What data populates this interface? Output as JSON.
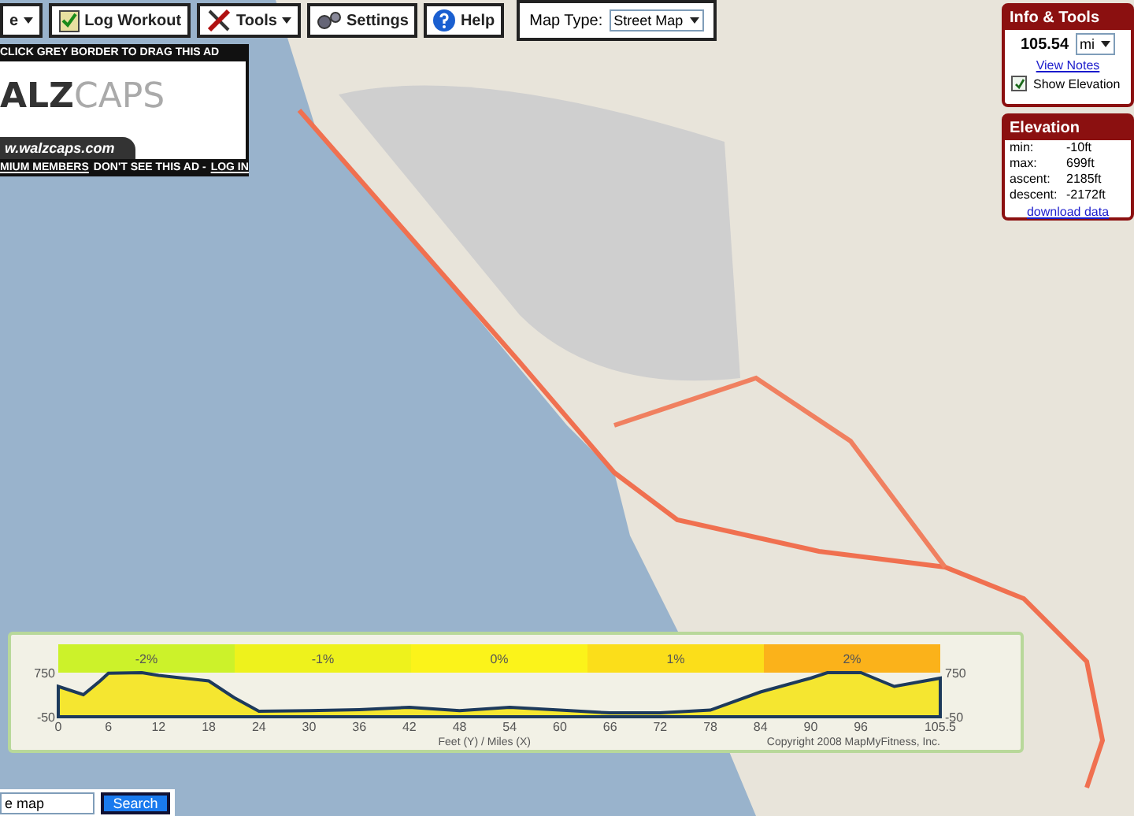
{
  "toolbar": {
    "items": [
      {
        "label": "e",
        "kind": "menu"
      },
      {
        "label": "Log Workout",
        "kind": "button"
      },
      {
        "label": "Tools",
        "kind": "menu"
      },
      {
        "label": "Settings",
        "kind": "button"
      },
      {
        "label": "Help",
        "kind": "button"
      }
    ],
    "map_type": {
      "label": "Map Type:",
      "value": "Street Map"
    }
  },
  "ad": {
    "header": "CLICK GREY BORDER TO DRAG THIS AD",
    "logo_left": "ALZ",
    "logo_right": "CAPS",
    "url": "w.walzcaps.com",
    "footer_link": "MIUM MEMBERS",
    "footer_text": "DON'T SEE THIS AD -",
    "footer_login": "LOG IN"
  },
  "info_panel": {
    "title": "Info & Tools",
    "distance": "105.54",
    "unit": "mi",
    "link": "View Notes",
    "show_elevation": {
      "label": "Show Elevation",
      "checked": true
    }
  },
  "elevation_panel": {
    "title": "Elevation",
    "stats": [
      {
        "label": "min:",
        "value": "-10ft"
      },
      {
        "label": "max:",
        "value": "699ft"
      },
      {
        "label": "ascent:",
        "value": "2185ft"
      },
      {
        "label": "descent:",
        "value": "-2172ft"
      }
    ],
    "link": "download data"
  },
  "elevation_chart": {
    "grade_bands": [
      {
        "label": "-2%",
        "color": "#ccf22a"
      },
      {
        "label": "-1%",
        "color": "#eef21c"
      },
      {
        "label": "0%",
        "color": "#fbf31a"
      },
      {
        "label": "1%",
        "color": "#fbde1a"
      },
      {
        "label": "2%",
        "color": "#fbb21a"
      }
    ],
    "right_axis_labels": [
      "750",
      "-50"
    ],
    "copyright": "Copyright 2008 MapMyFitness, Inc.",
    "chart_data": {
      "type": "area",
      "xlabel": "Feet (Y) / Miles (X)",
      "x": [
        0,
        3,
        5,
        6,
        10,
        12,
        18,
        21,
        24,
        30,
        36,
        42,
        48,
        54,
        60,
        66,
        72,
        78,
        84,
        90,
        92,
        96,
        100,
        105.5
      ],
      "series": [
        {
          "color": "#1d3a5c",
          "values": [
            500,
            350,
            600,
            740,
            750,
            700,
            600,
            300,
            50,
            60,
            80,
            120,
            60,
            120,
            70,
            20,
            20,
            70,
            400,
            650,
            750,
            750,
            500,
            650
          ]
        }
      ],
      "xlim": [
        0,
        105.5
      ],
      "ylim": [
        -50,
        750
      ],
      "xticks": [
        0,
        6,
        12,
        18,
        24,
        30,
        36,
        42,
        48,
        54,
        60,
        66,
        72,
        78,
        84,
        90,
        96,
        105.5
      ],
      "yticks": [
        -50,
        750
      ]
    }
  },
  "search": {
    "value": "e map",
    "button": "Search"
  }
}
